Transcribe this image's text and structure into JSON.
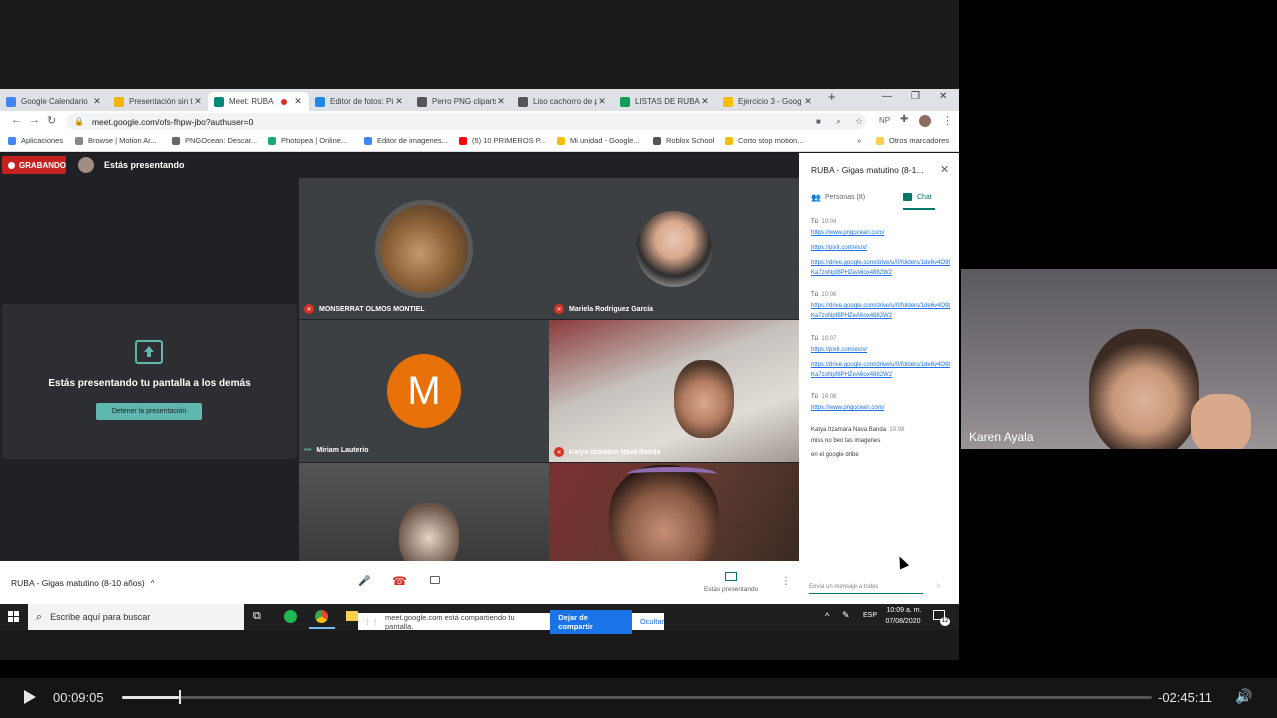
{
  "browser": {
    "tabs": [
      {
        "label": "Google Calendario",
        "color": "#4285f4"
      },
      {
        "label": "Presentación sin tí",
        "color": "#f4b400"
      },
      {
        "label": "Meet: RUBA",
        "color": "#00897b"
      },
      {
        "label": "Editor de fotos: Pi",
        "color": "#1e88e5"
      },
      {
        "label": "Perro PNG cliparts",
        "color": "#555555"
      },
      {
        "label": "Liso cachorro de p",
        "color": "#555555"
      },
      {
        "label": "LISTAS DE RUBA",
        "color": "#0f9d58"
      },
      {
        "label": "Ejercicio 3 - Goog",
        "color": "#fbbc04"
      }
    ],
    "new_tab": "+",
    "url": "meet.google.com/ofs-fhpw-jbo?authuser=0",
    "bookmarks": [
      "Aplicaciones",
      "Browse | Motion Ar...",
      "PNGOcean: Descar...",
      "Photopea | Online...",
      "Editor de imagenes...",
      "(5) 10 PRIMEROS P...",
      "Mi unidad - Google...",
      "Roblox School",
      "Corto stop motion..."
    ],
    "bookmarks_more": "»",
    "other_bookmarks": "Otros marcadores",
    "window_controls": [
      "—",
      "❐",
      "✕"
    ],
    "ext_np": "NP"
  },
  "meet": {
    "recording_label": "GRABANDO",
    "presenting_label": "Estás presentando",
    "present_card_title": "Estás presentando tu pantalla a los demás",
    "stop_button": "Detener la presentación",
    "participants": [
      {
        "name": "MONSERRAT OLMOS MONTIEL"
      },
      {
        "name": "Mariela Rodriguez García"
      },
      {
        "name": "Miriam Lauterio",
        "initial": "M"
      },
      {
        "name": "Katya Itzamara Nava Banda"
      }
    ],
    "meeting_name": "RUBA - Gigas matutino (8-10 años)",
    "present_bottom_label": "Estás presentando"
  },
  "chat_panel": {
    "title": "RUBA - Gigas matutino (8-1...",
    "tab_people": "Personas (8)",
    "tab_chat": "Chat",
    "messages": [
      {
        "sender": "Tú",
        "time": "10:04",
        "lines": [
          "https://www.pngocean.com/",
          "https://pixlr.com/es/x/",
          "https://drive.google.com/drive/u/0/folders/1de6v4O9tKa7zoNpf8PHZeA6ox4882W2"
        ]
      },
      {
        "sender": "Tú",
        "time": "10:06",
        "lines": [
          "https://drive.google.com/drive/u/0/folders/1de6v4O9tKa7zoNpf8PHZeA6ox4882W2"
        ]
      },
      {
        "sender": "Tú",
        "time": "10:07",
        "lines": [
          "https://pixlr.com/es/x/",
          "https://drive.google.com/drive/u/0/folders/1de6v4O9tKa7zoNpf8PHZeA6ox4882W2"
        ]
      },
      {
        "sender": "Tú",
        "time": "10:08",
        "lines": [
          "https://www.pngocean.com/"
        ]
      },
      {
        "sender": "Katya Itzamara Nava Banda",
        "time": "10:08",
        "lines": [
          "miss no beo las imagenes",
          "en el google dribe"
        ]
      }
    ],
    "input_placeholder": "Envía un mensaje a todos"
  },
  "taskbar": {
    "search_placeholder": "Escribe aquí para buscar",
    "share_text": "meet.google.com está compartiendo tu pantalla.",
    "share_stop": "Dejar de compartir",
    "share_hide": "Ocultar",
    "lang": "ESP",
    "time": "10:09 a. m.",
    "date": "07/08/2020",
    "notif_count": "12"
  },
  "webcam": {
    "name": "Karen Ayala"
  },
  "player": {
    "current_time": "00:09:05",
    "remaining_time": "-02:45:11",
    "progress": 0.055
  }
}
